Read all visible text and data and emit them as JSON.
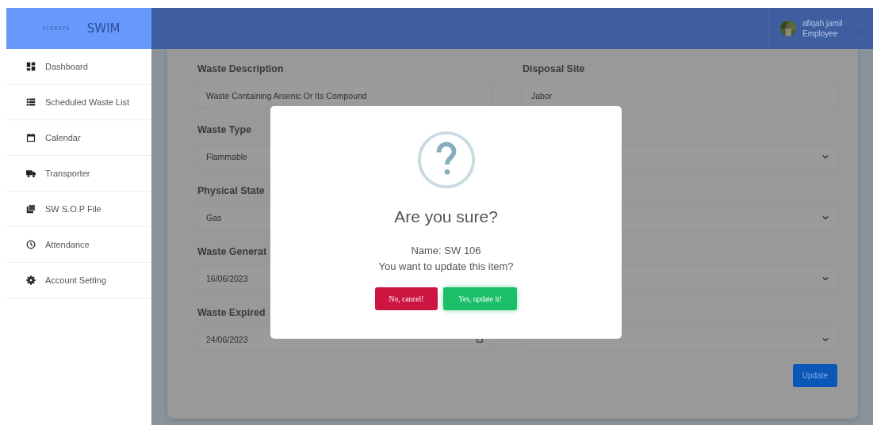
{
  "brand": {
    "logo": "FLEXSYS",
    "app_name": "SWIM"
  },
  "user": {
    "name": "afiqah jamil",
    "role": "Employee"
  },
  "sidebar": {
    "items": [
      {
        "label": "Dashboard"
      },
      {
        "label": "Scheduled Waste List"
      },
      {
        "label": "Calendar"
      },
      {
        "label": "Transporter"
      },
      {
        "label": "SW S.O.P File"
      },
      {
        "label": "Attendance"
      },
      {
        "label": "Account Setting"
      }
    ]
  },
  "form": {
    "left": [
      {
        "kind": "text",
        "label": "Waste Description",
        "value": "Waste Containing Arsenic Or Its Compound"
      },
      {
        "kind": "text",
        "label": "Waste Type",
        "value": "Flammable"
      },
      {
        "kind": "text",
        "label": "Physical State",
        "value": "Gas"
      },
      {
        "kind": "text",
        "label": "Waste Generat",
        "value": "16/06/2023"
      },
      {
        "kind": "date",
        "label": "Waste Expired",
        "value": "24/06/2023"
      }
    ],
    "right": [
      {
        "kind": "text",
        "label": "Disposal Site",
        "value": "Jabor"
      },
      {
        "kind": "select"
      },
      {
        "kind": "select"
      },
      {
        "kind": "select"
      },
      {
        "kind": "select"
      }
    ],
    "submit": "Update"
  },
  "dialog": {
    "title": "Are you sure?",
    "lines": [
      "Name: SW 106",
      "You want to update this item?"
    ],
    "buttons": [
      {
        "kind": "cancel",
        "label": "No, cancel!"
      },
      {
        "kind": "confirm",
        "label": "Yes, update it!"
      }
    ]
  }
}
